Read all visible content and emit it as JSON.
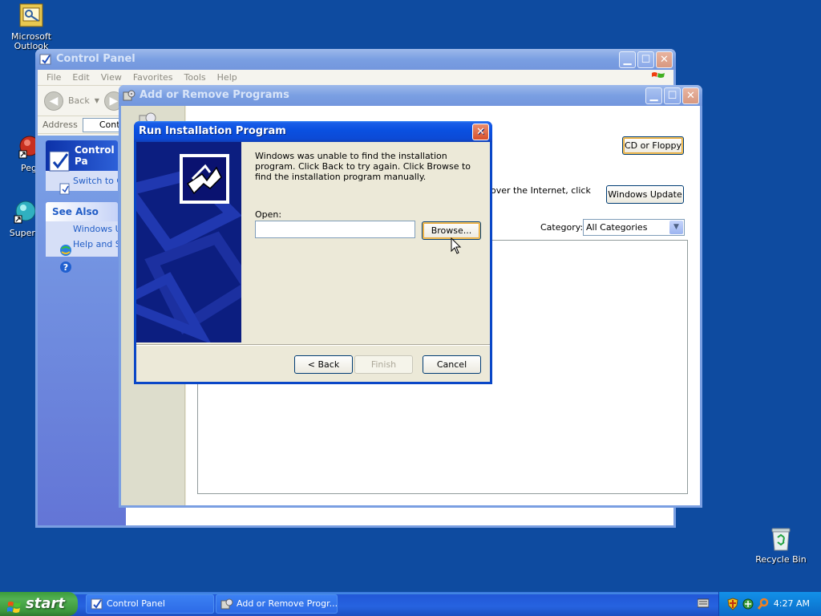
{
  "desktop": {
    "icons": [
      {
        "label_line1": "Microsoft",
        "label_line2": "Outlook",
        "icon": "outlook-icon"
      },
      {
        "label": "Peg",
        "icon": "pegasus-icon"
      },
      {
        "label": "Superr",
        "icon": "superr-icon"
      },
      {
        "label": "Recycle Bin",
        "icon": "recycle-bin-icon"
      }
    ]
  },
  "control_panel": {
    "title": "Control Panel",
    "menu": [
      "File",
      "Edit",
      "View",
      "Favorites",
      "Tools",
      "Help"
    ],
    "toolbar": {
      "back_label": "Back"
    },
    "address": {
      "label": "Address",
      "value": "Contr"
    },
    "left_pane": {
      "control_panel_box": {
        "title": "Control Pa",
        "switch_link": "Switch to C"
      },
      "see_also": {
        "title": "See Also",
        "items": [
          "Windows U",
          "Help and S"
        ]
      }
    },
    "fragments": {
      "a": "A",
      "c": "C",
      "s": "S",
      "a2": "A"
    }
  },
  "add_remove": {
    "title": "Add or Remove Programs",
    "cd_button": "CD or Floppy",
    "internet_text": "over the Internet, click",
    "update_button": "Windows Update",
    "category_label": "Category:",
    "category_value": "All Categories"
  },
  "dialog": {
    "title": "Run Installation Program",
    "message": "Windows was unable to find the installation program.  Click Back to try again.  Click Browse to find the installation program manually.",
    "open_label": "Open:",
    "open_value": "",
    "browse_button": "Browse...",
    "back_button": "< Back",
    "finish_button": "Finish",
    "cancel_button": "Cancel"
  },
  "taskbar": {
    "start_label": "start",
    "tasks": [
      {
        "label": "Control Panel",
        "icon": "control-panel-icon",
        "active": false
      },
      {
        "label": "Add or Remove Progr...",
        "icon": "add-remove-programs-icon",
        "active": true
      }
    ],
    "clock": "4:27 AM"
  },
  "colors": {
    "desktop": "#0e4ba0",
    "title_active": "#0a50e0",
    "title_inactive": "#7a9fe2",
    "dialog_face": "#ece9d8",
    "start_green": "#3c973c"
  }
}
